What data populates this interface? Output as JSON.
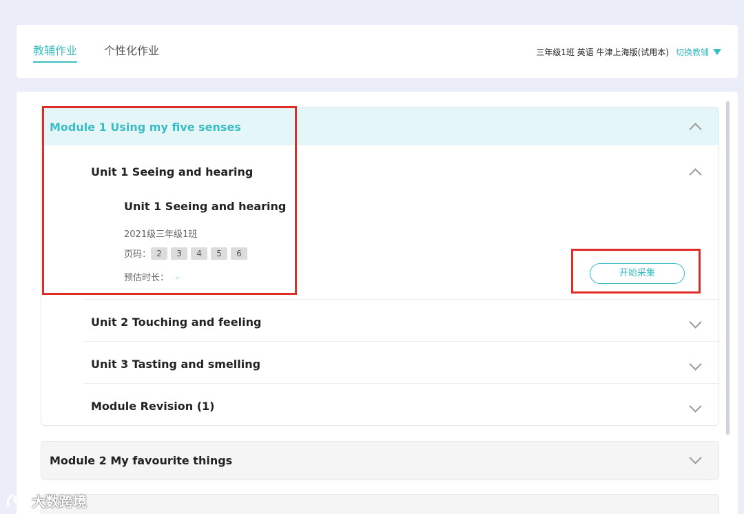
{
  "tabs": {
    "active": "教辅作业",
    "inactive": "个性化作业"
  },
  "header": {
    "class_info": "三年级1班 英语 牛津上海版(试用本)",
    "switch_label": "切换教辅"
  },
  "module1": {
    "title": "Module 1 Using my five senses",
    "units": [
      {
        "title": "Unit 1 Seeing and hearing"
      },
      {
        "title": "Unit 2 Touching and feeling"
      },
      {
        "title": "Unit 3 Tasting and smelling"
      },
      {
        "title": "Module Revision (1)"
      }
    ],
    "lesson": {
      "title": "Unit 1 Seeing and hearing",
      "class": "2021级三年级1班",
      "pages_label": "页码：",
      "pages": [
        "2",
        "3",
        "4",
        "5",
        "6"
      ],
      "est_label": "预估时长：",
      "est_value": "-",
      "start_button": "开始采集"
    }
  },
  "module2": {
    "title": "Module 2 My favourite things"
  },
  "watermark": {
    "text": "大数跨境"
  },
  "colors": {
    "accent": "#3bbdc4",
    "highlight_box": "#e02b27",
    "page_bg": "#ebeef8"
  }
}
